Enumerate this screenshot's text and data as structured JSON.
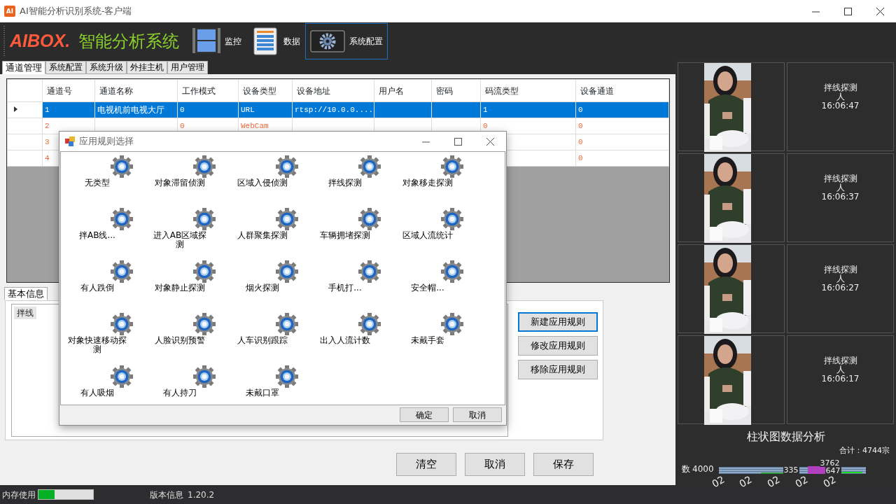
{
  "window": {
    "icon_text": "AI",
    "title": "AI智能分析识别系统-客户端"
  },
  "header": {
    "logo": "AIBOX.",
    "product": "智能分析系统",
    "nav": [
      {
        "kind": "film",
        "label": "监控",
        "selected": false
      },
      {
        "kind": "document",
        "label": "数据",
        "selected": false
      },
      {
        "kind": "gear",
        "label": "系统配置",
        "selected": true
      }
    ]
  },
  "tabs": [
    {
      "label": "通道管理",
      "selected": true
    },
    {
      "label": "系统配置",
      "selected": false
    },
    {
      "label": "系统升级",
      "selected": false
    },
    {
      "label": "外挂主机",
      "selected": false
    },
    {
      "label": "用户管理",
      "selected": false
    }
  ],
  "table": {
    "columns": [
      "通道号",
      "通道名称",
      "工作模式",
      "设备类型",
      "设备地址",
      "用户名",
      "密码",
      "码流类型",
      "设备通道"
    ],
    "rows": [
      {
        "selected": true,
        "channel_no": "1",
        "channel_name": "电视机前电视大厅",
        "work_mode": "0",
        "device_type": "URL",
        "device_address": "rtsp://10.0.0....",
        "stream_type": "1",
        "device_channel": "0"
      },
      {
        "selected": false,
        "channel_no": "2",
        "work_mode": "0",
        "device_type": "WebCam",
        "stream_type": "0",
        "device_channel": "0"
      },
      {
        "selected": false,
        "channel_no": "3",
        "device_channel": "0"
      },
      {
        "selected": false,
        "channel_no": "4",
        "device_channel": "0"
      }
    ]
  },
  "detail_tabs": [
    {
      "label": "基本信息",
      "selected": true
    }
  ],
  "rule_list": [
    {
      "label": "拌线",
      "selected": true
    }
  ],
  "rule_buttons": [
    {
      "label": "新建应用规则",
      "focused": true
    },
    {
      "label": "修改应用规则",
      "focused": false
    },
    {
      "label": "移除应用规则",
      "focused": false
    }
  ],
  "bottom_buttons": [
    "清空",
    "取消",
    "保存"
  ],
  "dialog": {
    "title": "应用规则选择",
    "rules": [
      "无类型",
      "对象滞留侦测",
      "区域入侵侦测",
      "拌线探测",
      "对象移走探测",
      "拌AB线...",
      "进入AB区域探测",
      "人群聚集探测",
      "车辆拥堵探测",
      "区域人流统计",
      "有人跌倒",
      "对象静止探测",
      "烟火探测",
      "手机打...",
      "安全帽...",
      "对象快速移动探测",
      "人脸识别预警",
      "人车识别跟踪",
      "出入人流计数",
      "未戴手套",
      "有人吸烟",
      "有人持刀",
      "未戴口罩"
    ],
    "buttons": [
      "确定",
      "取消"
    ]
  },
  "events": [
    {
      "rule": "拌线探测",
      "target": "人",
      "time": "16:06:47"
    },
    {
      "rule": "拌线探测",
      "target": "人",
      "time": "16:06:37"
    },
    {
      "rule": "拌线探测",
      "target": "人",
      "time": "16:06:27"
    },
    {
      "rule": "拌线探测",
      "target": "人",
      "time": "16:06:17"
    }
  ],
  "bar_chart": {
    "title": "柱状图数据分析",
    "total": "合计：4744宗",
    "axis_label": "数",
    "axis_tick": "4000",
    "value_labels": [
      "335",
      "3762",
      "647"
    ],
    "x_labels": [
      "02",
      "02",
      "02",
      "02",
      "02"
    ]
  },
  "status_bar": {
    "memory_label": "内存使用",
    "memory": {
      "level": 0.3
    },
    "version_label": "版本信息",
    "version": "1.20.2"
  }
}
